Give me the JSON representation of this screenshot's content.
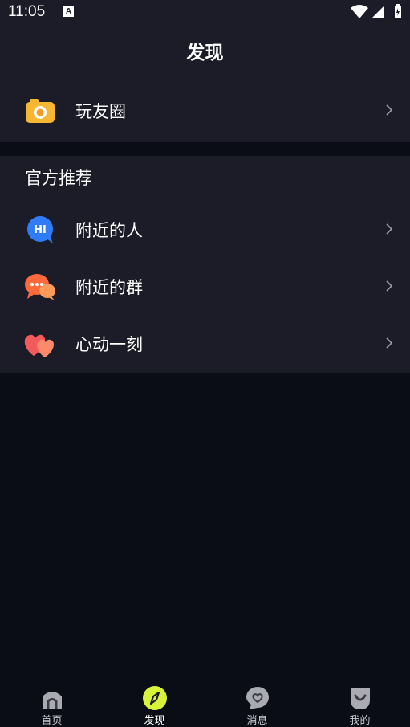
{
  "status_bar": {
    "time": "11:05",
    "notification_letter": "A"
  },
  "header": {
    "title": "发现"
  },
  "moments": {
    "label": "玩友圈",
    "icon": "camera-icon"
  },
  "official": {
    "heading": "官方推荐",
    "items": [
      {
        "label": "附近的人",
        "icon": "hi-bubble-icon"
      },
      {
        "label": "附近的群",
        "icon": "group-chat-icon"
      },
      {
        "label": "心动一刻",
        "icon": "hearts-icon"
      }
    ]
  },
  "tabs": [
    {
      "label": "首页",
      "icon": "home-icon",
      "active": false
    },
    {
      "label": "发现",
      "icon": "compass-icon",
      "active": true
    },
    {
      "label": "消息",
      "icon": "message-heart-icon",
      "active": false
    },
    {
      "label": "我的",
      "icon": "profile-smile-icon",
      "active": false
    }
  ],
  "colors": {
    "background": "#0b0d16",
    "panel": "#1b1c28",
    "accent": "#d9f23a"
  }
}
